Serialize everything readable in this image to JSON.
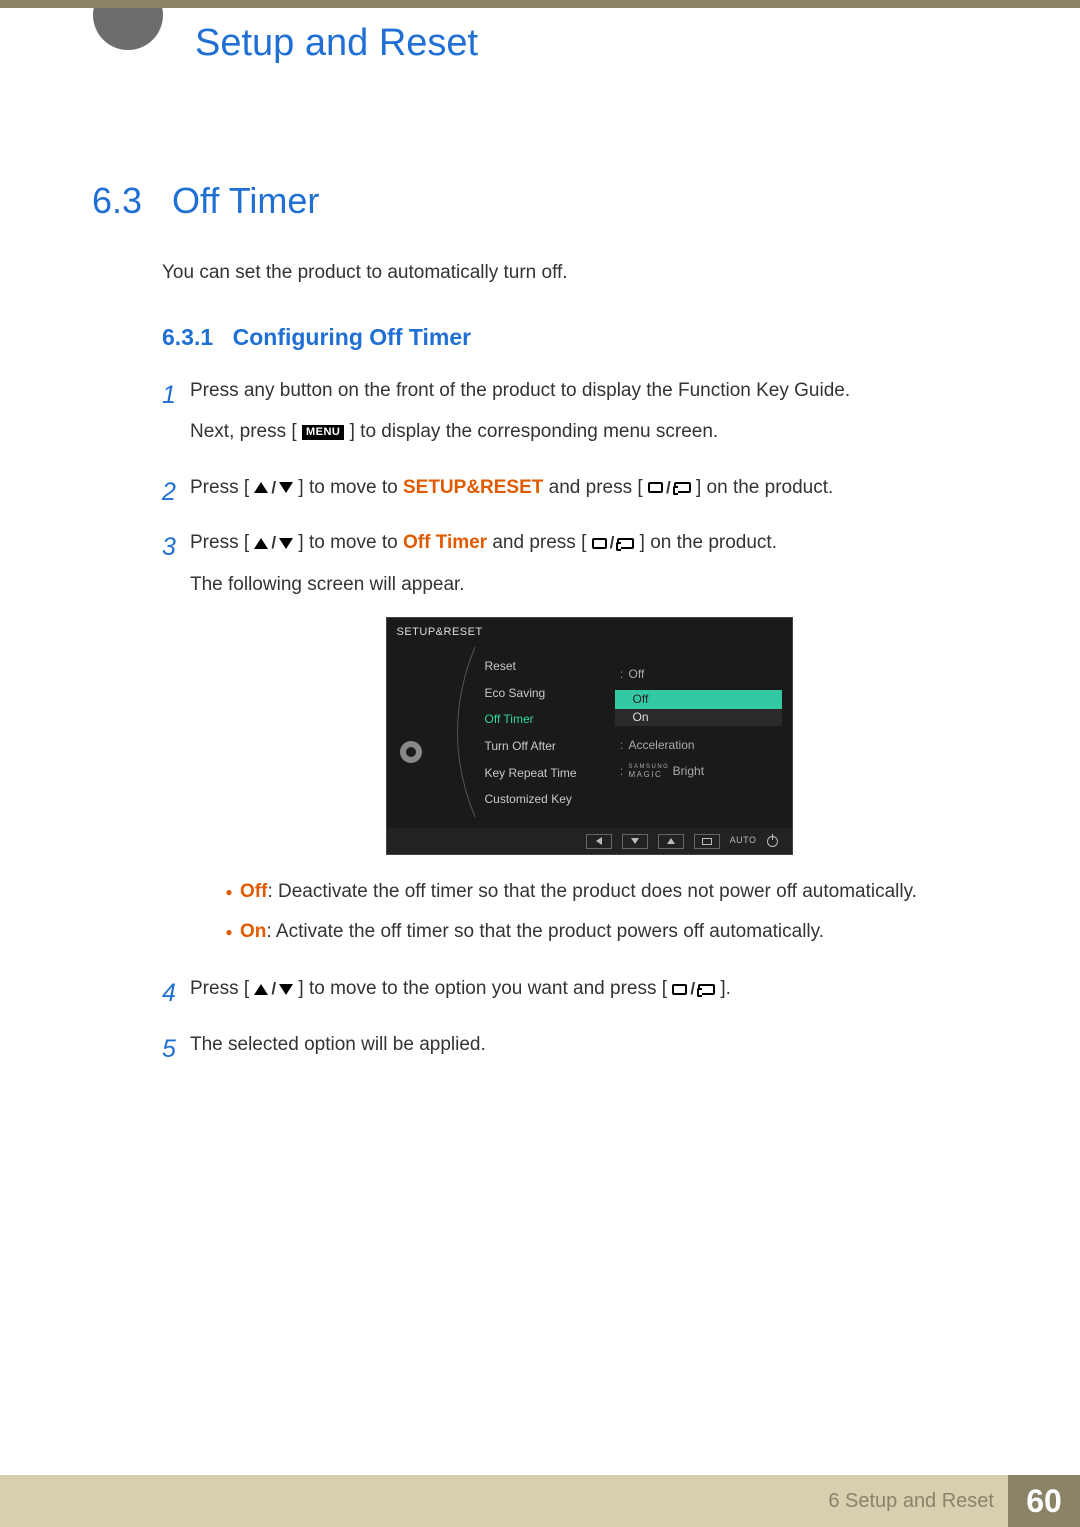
{
  "header": {
    "chapter_title": "Setup and Reset"
  },
  "section": {
    "number": "6.3",
    "title": "Off Timer",
    "intro": "You can set the product to automatically turn off."
  },
  "subsection": {
    "number": "6.3.1",
    "title": "Configuring Off Timer"
  },
  "steps": {
    "s1": {
      "num": "1",
      "p1": "Press any button on the front of the product to display the Function Key Guide.",
      "p2a": "Next, press [",
      "menu": "MENU",
      "p2b": "] to display the corresponding menu screen."
    },
    "s2": {
      "num": "2",
      "a": "Press [",
      "b": "] to move to ",
      "target": "SETUP&RESET",
      "c": " and press [",
      "d": "] on the product."
    },
    "s3": {
      "num": "3",
      "a": "Press [",
      "b": "] to move to ",
      "target": "Off Timer",
      "c": " and press [",
      "d": "] on the product.",
      "p2": "The following screen will appear."
    },
    "s4": {
      "num": "4",
      "a": "Press [",
      "b": "] to move to the option you want and press [",
      "c": "]."
    },
    "s5": {
      "num": "5",
      "text": "The selected option will be applied."
    }
  },
  "bullets": {
    "off": {
      "label": "Off",
      "text": ": Deactivate the off timer so that the product does not power off automatically."
    },
    "on": {
      "label": "On",
      "text": ": Activate the off timer so that the product powers off automatically."
    }
  },
  "osd": {
    "title": "SETUP&RESET",
    "items": {
      "reset": "Reset",
      "eco": "Eco Saving",
      "off_timer": "Off Timer",
      "turn_off_after": "Turn Off After",
      "key_repeat": "Key Repeat Time",
      "custom_key": "Customized Key"
    },
    "values": {
      "eco": "Off",
      "off_timer_sel": "Off",
      "off_timer_alt": "On",
      "key_repeat": "Acceleration",
      "custom_key_brand_top": "SAMSUNG",
      "custom_key_brand_bot": "MAGIC",
      "custom_key_suffix": " Bright"
    },
    "footer": {
      "auto": "AUTO"
    }
  },
  "footer": {
    "chapter": "6 Setup and Reset",
    "page": "60"
  }
}
